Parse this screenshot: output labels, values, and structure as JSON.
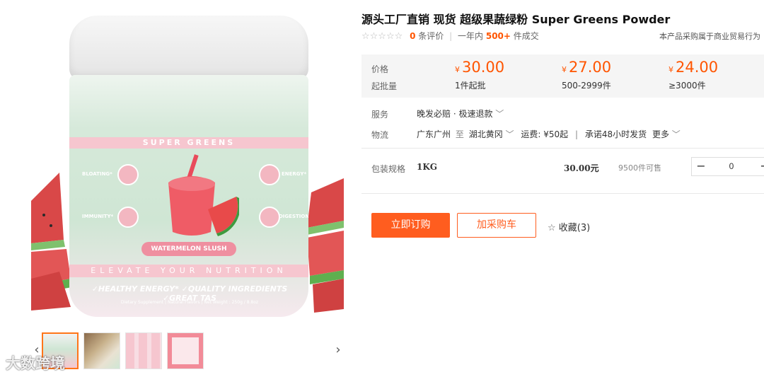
{
  "product": {
    "title": "源头工厂直销 现货 超级果蔬绿粉 Super Greens Powder",
    "stars": "☆☆☆☆☆",
    "review_count": "0",
    "review_label": "条评价",
    "sold_period": "一年内",
    "sold_count": "500+",
    "sold_label": "件成交",
    "trade_note": "本产品采购属于商业贸易行为"
  },
  "pricing": {
    "price_label": "价格",
    "moq_label": "起批量",
    "currency": "¥",
    "tiers": [
      {
        "price": "30.00",
        "qty": "1件起批"
      },
      {
        "price": "27.00",
        "qty": "500-2999件"
      },
      {
        "price": "24.00",
        "qty": "≥3000件"
      }
    ]
  },
  "service": {
    "label": "服务",
    "value": "晚发必赔 · 极速退款",
    "chevron": "﹀"
  },
  "logistics": {
    "label": "物流",
    "from": "广东广州",
    "to_word": "至",
    "to": "湖北黄冈",
    "chevron": "﹀",
    "shipping": "运费: ¥50起",
    "promise": "承诺48小时发货",
    "more": "更多"
  },
  "sku": {
    "label": "包装规格",
    "spec": "1KG",
    "price": "30.00元",
    "stock": "9500件可售",
    "quantity": "0",
    "minus": "−",
    "plus": "+"
  },
  "actions": {
    "buy_now": "立即订购",
    "add_cart": "加采购车",
    "favorite": "收藏(3)"
  },
  "gallery": {
    "jar_title": "SUPER GREENS",
    "benefit_1": "BLOATING*",
    "benefit_2": "ENERGY*",
    "benefit_3": "IMMUNITY*",
    "benefit_4": "DIGESTION*",
    "flavor": "WATERMELON SLUSH",
    "slogan": "ELEVATE YOUR NUTRITION",
    "claims": "✓HEALTHY ENERGY*  ✓QUALITY INGREDIENTS  ✓GREAT TAS",
    "fineprint": "Dietary Supplement | Natural Flavors | Net Weight : 250g / 8.8oz",
    "prev_arrow": "‹",
    "next_arrow": "›",
    "watermark": "大数跨境"
  },
  "colors": {
    "accent": "#ff5500",
    "button": "#ff5d1f",
    "price_bg": "#f5f5f5",
    "jar_green": "#cfe6d4",
    "jar_pink": "#f6c6cf"
  }
}
